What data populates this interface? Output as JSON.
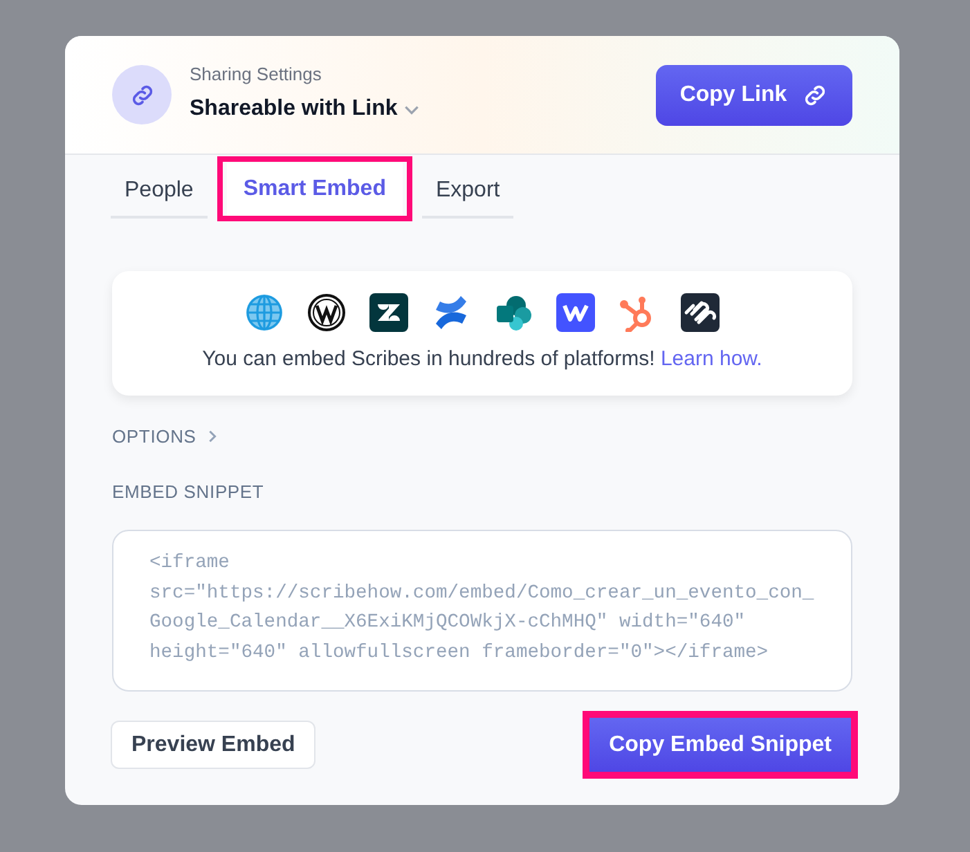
{
  "header": {
    "caption": "Sharing Settings",
    "sharing_mode": "Shareable with Link",
    "copy_button": "Copy Link"
  },
  "tabs": [
    {
      "label": "People",
      "selected": false,
      "highlighted": false
    },
    {
      "label": "Smart Embed",
      "selected": true,
      "highlighted": true
    },
    {
      "label": "Export",
      "selected": false,
      "highlighted": false
    }
  ],
  "platforms_card": {
    "text": "You can embed Scribes in hundreds of platforms!",
    "link": "Learn how."
  },
  "options": {
    "label": "OPTIONS",
    "expanded": false
  },
  "snippet": {
    "label": "EMBED SNIPPET",
    "code": "<iframe src=\"https://scribehow.com/embed/Como_crear_un_evento_con_Google_Calendar__X6ExiKMjQCOWkjX-cChMHQ\" width=\"640\" height=\"640\" allowfullscreen frameborder=\"0\"></iframe>"
  },
  "buttons": [
    {
      "label": "Preview Embed",
      "kind": "secondary",
      "highlighted": false
    },
    {
      "label": "Copy Embed Snippet",
      "kind": "primary",
      "highlighted": true
    }
  ]
}
